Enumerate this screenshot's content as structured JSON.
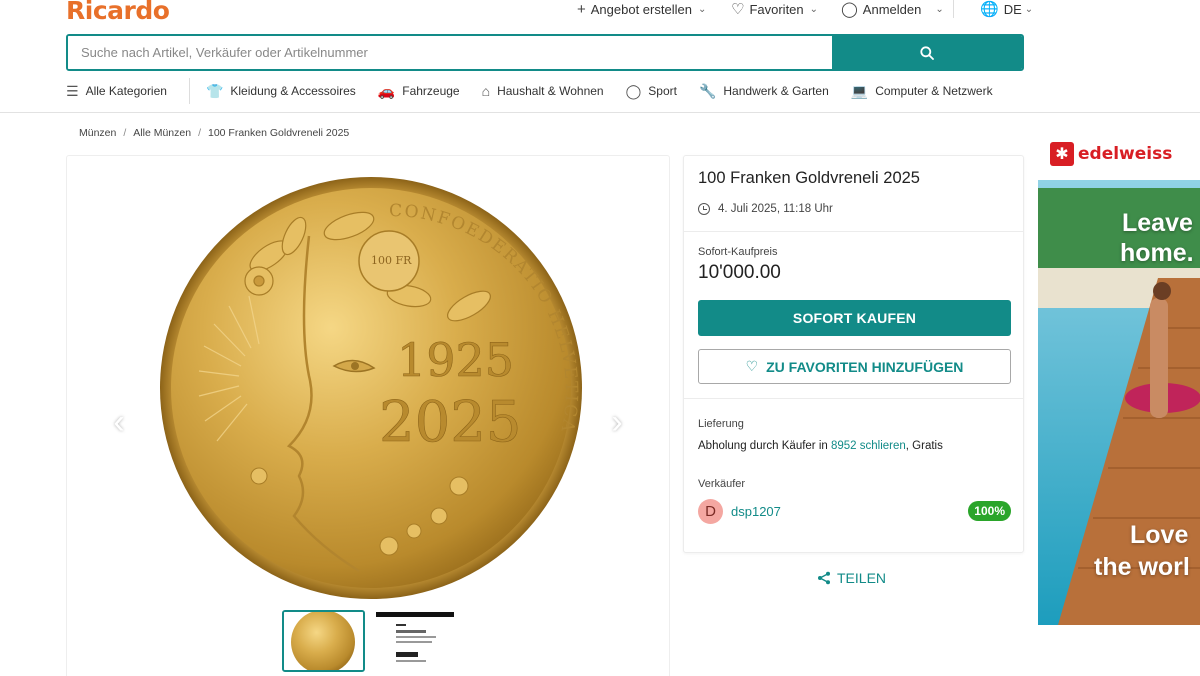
{
  "header": {
    "logo": "Ricardo",
    "offer_label": "Angebot erstellen",
    "favorites_label": "Favoriten",
    "login_label": "Anmelden",
    "lang_label": "DE"
  },
  "search": {
    "placeholder": "Suche nach Artikel, Verkäufer oder Artikelnummer"
  },
  "categories": [
    {
      "label": "Alle Kategorien",
      "icon": "menu-icon"
    },
    {
      "label": "Kleidung & Accessoires",
      "icon": "shirt-icon"
    },
    {
      "label": "Fahrzeuge",
      "icon": "car-icon"
    },
    {
      "label": "Haushalt & Wohnen",
      "icon": "house-icon"
    },
    {
      "label": "Sport",
      "icon": "ball-icon"
    },
    {
      "label": "Handwerk & Garten",
      "icon": "tools-icon"
    },
    {
      "label": "Computer & Netzwerk",
      "icon": "laptop-icon"
    }
  ],
  "breadcrumb": [
    "Münzen",
    "Alle Münzen",
    "100 Franken Goldvreneli 2025"
  ],
  "listing": {
    "title": "100 Franken Goldvreneli 2025",
    "date": "4. Juli 2025, 11:18 Uhr",
    "price_label": "Sofort-Kaufpreis",
    "price": "10'000.00",
    "buy_label": "SOFORT KAUFEN",
    "fav_label": "ZU FAVORITEN HINZUFÜGEN",
    "delivery_label": "Lieferung",
    "delivery_prefix": "Abholung durch Käufer in ",
    "delivery_location": "8952 schlieren",
    "delivery_suffix": ", Gratis",
    "seller_label": "Verkäufer",
    "seller_initial": "D",
    "seller_name": "dsp1207",
    "seller_rating": "100%",
    "share_label": "TEILEN"
  },
  "coin": {
    "year_top": "1925",
    "year_bottom": "2025",
    "inscription": "CONFOEDERATIO HELVETICA",
    "small_value": "100 FR"
  },
  "ad": {
    "brand": "edelweiss",
    "line1": "Leave",
    "line2": "home.",
    "line3": "Love",
    "line4": "the worl"
  },
  "colors": {
    "accent": "#128b88",
    "brand_orange": "#e8702a",
    "rating_green": "#2aa52a"
  }
}
